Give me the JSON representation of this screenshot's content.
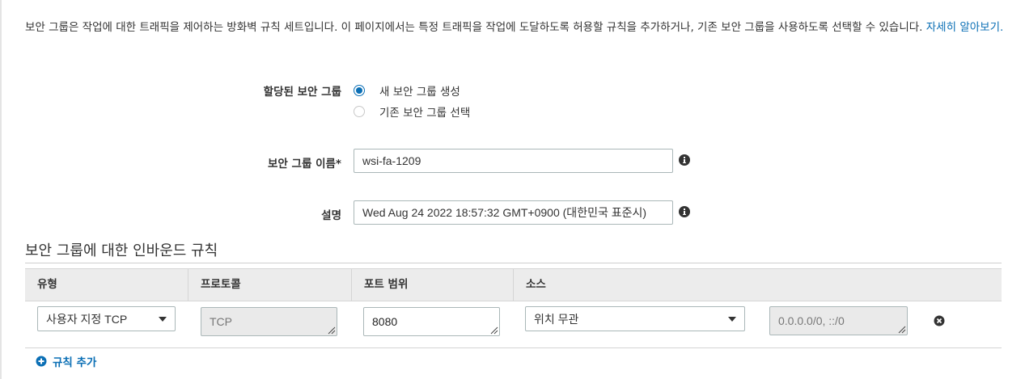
{
  "intro": {
    "text": "보안 그룹은 작업에 대한 트래픽을 제어하는 방화벽 규칙 세트입니다. 이 페이지에서는 특정 트래픽을 작업에 도달하도록 허용할 규칙을 추가하거나, 기존 보안 그룹을 사용하도록 선택할 수 있습니다. ",
    "learn_more": "자세히 알아보기."
  },
  "assigned_group": {
    "label": "할당된 보안 그룹",
    "options": [
      {
        "label": "새 보안 그룹 생성",
        "selected": true
      },
      {
        "label": "기존 보안 그룹 선택",
        "selected": false
      }
    ]
  },
  "group_name": {
    "label": "보안 그룹 이름*",
    "value": "wsi-fa-1209"
  },
  "description": {
    "label": "설명",
    "value": "Wed Aug 24 2022 18:57:32 GMT+0900 (대한민국 표준시)"
  },
  "inbound": {
    "title": "보안 그룹에 대한 인바운드 규칙",
    "headers": {
      "type": "유형",
      "protocol": "프로토콜",
      "port_range": "포트 범위",
      "source": "소스"
    },
    "rules": [
      {
        "type": "사용자 지정 TCP",
        "protocol": "TCP",
        "port_range": "8080",
        "source": "위치 무관",
        "cidr": "0.0.0.0/0, ::/0"
      }
    ],
    "add_rule_label": "규칙 추가"
  },
  "colors": {
    "accent": "#0b6fb5",
    "header_bg": "#ececec",
    "disabled_bg": "#eaeaea"
  },
  "icons": [
    "info-icon",
    "remove-circle-icon",
    "add-circle-icon",
    "dropdown-caret-icon",
    "resize-grip-icon"
  ]
}
